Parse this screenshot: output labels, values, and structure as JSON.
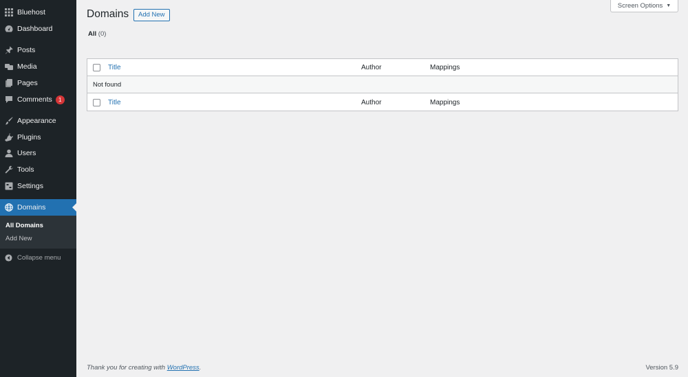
{
  "sidebar": {
    "items": [
      {
        "label": "Bluehost",
        "icon": "grid-icon"
      },
      {
        "label": "Dashboard",
        "icon": "dashboard-icon"
      },
      {
        "label": "Posts",
        "icon": "pin-icon"
      },
      {
        "label": "Media",
        "icon": "media-icon"
      },
      {
        "label": "Pages",
        "icon": "pages-icon"
      },
      {
        "label": "Comments",
        "icon": "comment-icon",
        "badge": "1"
      },
      {
        "label": "Appearance",
        "icon": "brush-icon"
      },
      {
        "label": "Plugins",
        "icon": "plugin-icon"
      },
      {
        "label": "Users",
        "icon": "user-icon"
      },
      {
        "label": "Tools",
        "icon": "wrench-icon"
      },
      {
        "label": "Settings",
        "icon": "settings-icon"
      },
      {
        "label": "Domains",
        "icon": "globe-icon",
        "current": true
      }
    ],
    "submenu": [
      "All Domains",
      "Add New"
    ],
    "collapse_label": "Collapse menu"
  },
  "header": {
    "title": "Domains",
    "add_new_label": "Add New",
    "screen_options_label": "Screen Options",
    "screen_options_arrow": "▼"
  },
  "views": {
    "all_label": "All",
    "all_count": "(0)"
  },
  "table": {
    "columns": [
      "Title",
      "Author",
      "Mappings"
    ],
    "empty_message": "Not found"
  },
  "footer": {
    "thanks_prefix": "Thank you for creating with ",
    "thanks_link": "WordPress",
    "thanks_suffix": ".",
    "version": "Version 5.9"
  },
  "colors": {
    "sidebar_bg": "#1d2327",
    "accent": "#2271b1",
    "badge": "#d63638",
    "page_bg": "#f0f0f1"
  }
}
